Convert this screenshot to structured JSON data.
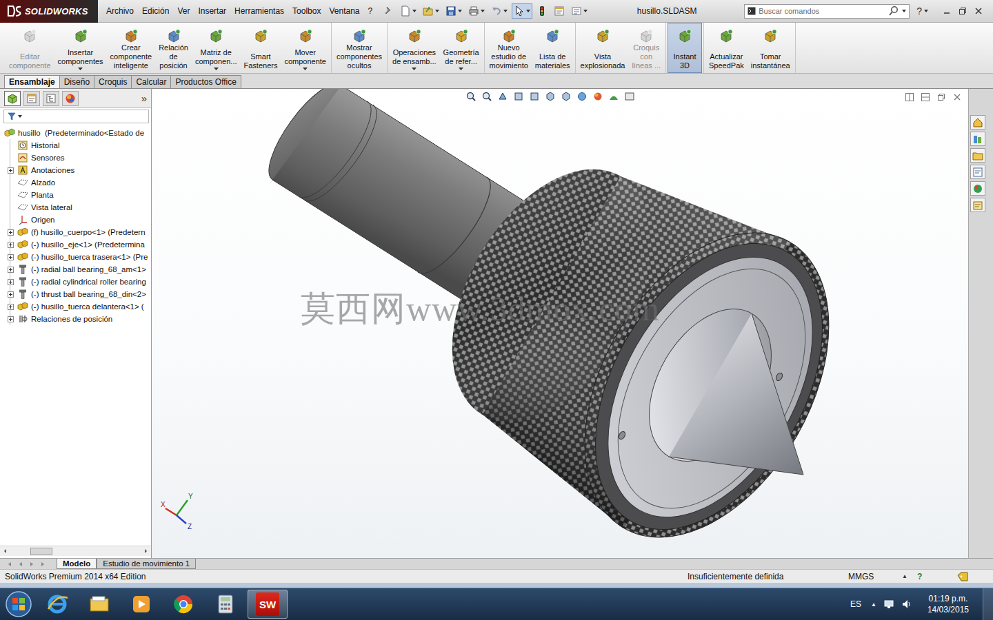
{
  "app": {
    "logo": "SOLIDWORKS",
    "title": "husillo.SLDASM"
  },
  "menu": [
    "Archivo",
    "Edición",
    "Ver",
    "Insertar",
    "Herramientas",
    "Toolbox",
    "Ventana",
    "?"
  ],
  "quick_access": [
    {
      "kind": "pin",
      "selected": false,
      "dropdown": false
    },
    {
      "kind": "new",
      "selected": false,
      "dropdown": true
    },
    {
      "kind": "open",
      "selected": false,
      "dropdown": true
    },
    {
      "kind": "save",
      "selected": false,
      "dropdown": true
    },
    {
      "kind": "print",
      "selected": false,
      "dropdown": true
    },
    {
      "kind": "undo",
      "selected": false,
      "dropdown": true
    },
    {
      "kind": "select",
      "selected": true,
      "dropdown": true
    },
    {
      "kind": "rebuild",
      "selected": false,
      "dropdown": false
    },
    {
      "kind": "properties",
      "selected": false,
      "dropdown": false
    },
    {
      "kind": "options",
      "selected": false,
      "dropdown": true
    }
  ],
  "search": {
    "placeholder": "Buscar comandos"
  },
  "help": "?",
  "ribbon": [
    {
      "buttons": [
        {
          "lines": [
            "Editar",
            "componente"
          ],
          "disabled": true,
          "selected": false,
          "dropdown": false
        },
        {
          "lines": [
            "Insertar",
            "componentes"
          ],
          "disabled": false,
          "selected": false,
          "dropdown": true
        },
        {
          "lines": [
            "Crear",
            "componente",
            "inteligente"
          ],
          "disabled": false,
          "selected": false,
          "dropdown": false
        },
        {
          "lines": [
            "Relación",
            "de",
            "posición"
          ],
          "disabled": false,
          "selected": false,
          "dropdown": false
        },
        {
          "lines": [
            "Matriz de",
            "componen..."
          ],
          "disabled": false,
          "selected": false,
          "dropdown": true
        },
        {
          "lines": [
            "Smart",
            "Fasteners"
          ],
          "disabled": false,
          "selected": false,
          "dropdown": false
        },
        {
          "lines": [
            "Mover",
            "componente"
          ],
          "disabled": false,
          "selected": false,
          "dropdown": true
        }
      ]
    },
    {
      "buttons": [
        {
          "lines": [
            "Mostrar",
            "componentes",
            "ocultos"
          ],
          "disabled": false,
          "selected": false,
          "dropdown": false
        }
      ]
    },
    {
      "buttons": [
        {
          "lines": [
            "Operaciones",
            "de ensamb..."
          ],
          "disabled": false,
          "selected": false,
          "dropdown": true
        },
        {
          "lines": [
            "Geometría",
            "de refer..."
          ],
          "disabled": false,
          "selected": false,
          "dropdown": true
        }
      ]
    },
    {
      "buttons": [
        {
          "lines": [
            "Nuevo",
            "estudio de",
            "movimiento"
          ],
          "disabled": false,
          "selected": false,
          "dropdown": false
        },
        {
          "lines": [
            "Lista de",
            "materiales"
          ],
          "disabled": false,
          "selected": false,
          "dropdown": false
        }
      ]
    },
    {
      "buttons": [
        {
          "lines": [
            "Vista",
            "explosionada"
          ],
          "disabled": false,
          "selected": false,
          "dropdown": false
        },
        {
          "lines": [
            "Croquis",
            "con",
            "líneas ..."
          ],
          "disabled": true,
          "selected": false,
          "dropdown": false
        }
      ]
    },
    {
      "buttons": [
        {
          "lines": [
            "Instant",
            "3D"
          ],
          "disabled": false,
          "selected": true,
          "dropdown": false
        }
      ]
    },
    {
      "buttons": [
        {
          "lines": [
            "Actualizar",
            "SpeedPak"
          ],
          "disabled": false,
          "selected": false,
          "dropdown": false
        },
        {
          "lines": [
            "Tomar",
            "instantánea"
          ],
          "disabled": false,
          "selected": false,
          "dropdown": false
        }
      ]
    }
  ],
  "tabs": [
    {
      "label": "Ensamblaje",
      "selected": true
    },
    {
      "label": "Diseño",
      "selected": false
    },
    {
      "label": "Croquis",
      "selected": false
    },
    {
      "label": "Calcular",
      "selected": false
    },
    {
      "label": "Productos Office",
      "selected": false
    }
  ],
  "feature_manager": {
    "collapse": "»",
    "panel_tabs": [
      {
        "kind": "feature",
        "selected": true
      },
      {
        "kind": "property",
        "selected": false
      },
      {
        "kind": "config",
        "selected": false
      },
      {
        "kind": "appearance",
        "selected": false
      }
    ],
    "tree": [
      {
        "label": "husillo  (Predeterminado<Estado de",
        "depth": 0,
        "expandable": false,
        "expanded": true,
        "kind": "assembly"
      },
      {
        "label": "Historial",
        "depth": 1,
        "expandable": false,
        "expanded": false,
        "kind": "history"
      },
      {
        "label": "Sensores",
        "depth": 1,
        "expandable": false,
        "expanded": false,
        "kind": "sensor"
      },
      {
        "label": "Anotaciones",
        "depth": 1,
        "expandable": true,
        "expanded": false,
        "kind": "annotation"
      },
      {
        "label": "Alzado",
        "depth": 1,
        "expandable": false,
        "expanded": false,
        "kind": "plane"
      },
      {
        "label": "Planta",
        "depth": 1,
        "expandable": false,
        "expanded": false,
        "kind": "plane"
      },
      {
        "label": "Vista lateral",
        "depth": 1,
        "expandable": false,
        "expanded": false,
        "kind": "plane"
      },
      {
        "label": "Origen",
        "depth": 1,
        "expandable": false,
        "expanded": false,
        "kind": "origin"
      },
      {
        "label": "(f) husillo_cuerpo<1> (Predetern",
        "depth": 1,
        "expandable": true,
        "expanded": false,
        "kind": "part"
      },
      {
        "label": "(-) husillo_eje<1> (Predetermina",
        "depth": 1,
        "expandable": true,
        "expanded": false,
        "kind": "part"
      },
      {
        "label": "(-) husillo_tuerca trasera<1> (Pre",
        "depth": 1,
        "expandable": true,
        "expanded": false,
        "kind": "part"
      },
      {
        "label": "(-) radial ball bearing_68_am<1>",
        "depth": 1,
        "expandable": true,
        "expanded": false,
        "kind": "fastener"
      },
      {
        "label": "(-) radial cylindrical roller bearing",
        "depth": 1,
        "expandable": true,
        "expanded": false,
        "kind": "fastener"
      },
      {
        "label": "(-) thrust ball bearing_68_din<2>",
        "depth": 1,
        "expandable": true,
        "expanded": false,
        "kind": "fastener"
      },
      {
        "label": "(-) husillo_tuerca delantera<1> (",
        "depth": 1,
        "expandable": true,
        "expanded": false,
        "kind": "part"
      },
      {
        "label": "Relaciones de posición",
        "depth": 1,
        "expandable": true,
        "expanded": false,
        "kind": "mates"
      }
    ]
  },
  "viewport": {
    "watermark": "莫西网www.3dmox.com",
    "axes": [
      "X",
      "Y",
      "Z"
    ]
  },
  "task_pane": [
    {
      "kind": "home"
    },
    {
      "kind": "library"
    },
    {
      "kind": "explorer"
    },
    {
      "kind": "search"
    },
    {
      "kind": "appearances"
    },
    {
      "kind": "custom"
    }
  ],
  "bottom_tabs": [
    {
      "label": "Modelo",
      "selected": true
    },
    {
      "label": "Estudio de movimiento 1",
      "selected": false
    }
  ],
  "status_bar": {
    "edition": "SolidWorks Premium 2014 x64 Edition",
    "state": "Insuficientemente definida",
    "units": "MMGS",
    "units_arrow": "▲",
    "help": "?"
  },
  "taskbar": {
    "apps": [
      {
        "kind": "ie",
        "active": false,
        "label": ""
      },
      {
        "kind": "explorer",
        "active": false,
        "label": ""
      },
      {
        "kind": "media",
        "active": false,
        "label": ""
      },
      {
        "kind": "chrome",
        "active": false,
        "label": ""
      },
      {
        "kind": "calculator",
        "active": false,
        "label": ""
      },
      {
        "kind": "solidworks",
        "active": true,
        "label": "SW"
      }
    ],
    "language": "ES",
    "tray_arrow": "▲",
    "time": "01:19 p.m.",
    "date": "14/03/2015"
  }
}
